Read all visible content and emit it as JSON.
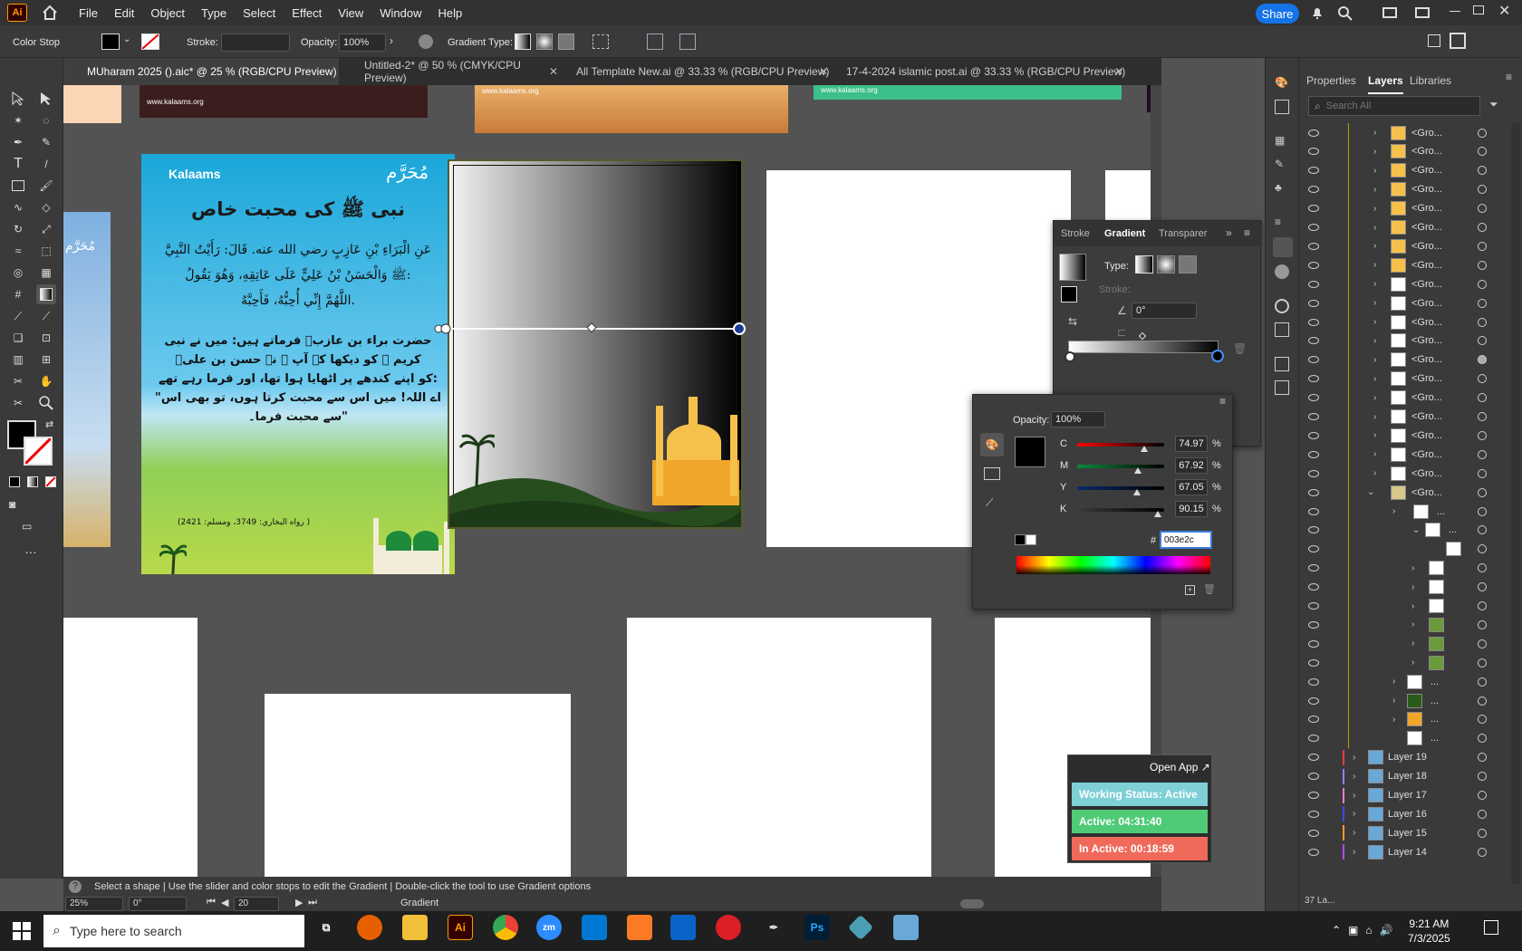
{
  "menubar": {
    "app_icon": "Ai",
    "items": [
      "File",
      "Edit",
      "Object",
      "Type",
      "Select",
      "Effect",
      "View",
      "Window",
      "Help"
    ],
    "share": "Share"
  },
  "control": {
    "mode": "Color Stop",
    "stroke_label": "Stroke:",
    "opacity_label": "Opacity:",
    "opacity": "100%",
    "gradient_type_label": "Gradient Type:"
  },
  "tabs": [
    {
      "label": "MUharam 2025 ().aic* @ 25 % (RGB/CPU Preview)",
      "active": true
    },
    {
      "label": "Untitled-2* @ 50 % (CMYK/CPU Preview)",
      "active": false
    },
    {
      "label": "All Template New.ai @ 33.33 % (RGB/CPU Preview)",
      "active": false
    },
    {
      "label": "17-4-2024 islamic post.ai @ 33.33 % (RGB/CPU Preview)",
      "active": false
    }
  ],
  "artwork": {
    "brand": "Kalaams",
    "site": "www.kalaams.org",
    "muharram": "مُحَرَّم",
    "title": "نبی ﷺ کی محبت خاص",
    "arabic": [
      "عَنِ الْبَرَاءِ بْنِ عَازِبٍ رضي الله عنه. قَالَ: رَأَيْتُ النَّبِيَّ",
      "ﷺ وَالْحَسَنُ بْنُ عَلِيٍّ عَلَى عَاتِقِهِ، وَهُوَ يَقُولُ:",
      "اللَّهُمَّ إِنِّي أُحِبُّهُ، فَأَحِبَّهُ."
    ],
    "urdu": [
      "حضرت براء بن عازبؓ فرماتے ہیں: میں نے نبی",
      "کریم ﷺ کو دیکھا کہ آپ ﷺ نے حسن بن علیؓ",
      "کو اپنے کندھے پر اٹھایا ہوا تھا، اور فرما رہے تھے:",
      "\"اے اللہ! میں اس سے محبت کرتا ہوں، تو بھی اس",
      "سے محبت فرما۔\""
    ],
    "ref": "(رواه البخاري: 3749، ومسلم: 2421 )"
  },
  "gradient_panel": {
    "tabs": [
      "Stroke",
      "Gradient",
      "Transparer"
    ],
    "type_label": "Type:",
    "stroke_label": "Stroke:",
    "angle": "0°"
  },
  "color_panel": {
    "opacity_label": "Opacity:",
    "opacity": "100%",
    "channels": [
      {
        "label": "C",
        "value": "74.97",
        "pct": 0.7497,
        "color": "#00aeef"
      },
      {
        "label": "M",
        "value": "67.92",
        "pct": 0.6792,
        "color": "#ec008c"
      },
      {
        "label": "Y",
        "value": "67.05",
        "pct": 0.6705,
        "color": "#fff200"
      },
      {
        "label": "K",
        "value": "90.15",
        "pct": 0.9015,
        "color": "#aaaaaa"
      }
    ],
    "pct_sign": "%",
    "hash": "#",
    "hex": "003e2c"
  },
  "layers_panel": {
    "tabs": [
      "Properties",
      "Layers",
      "Libraries"
    ],
    "search_placeholder": "Search All",
    "group_label": "<Gro...",
    "ellipsis": "...",
    "named_layers": [
      {
        "name": "Layer 19",
        "color": "#ff3b3b"
      },
      {
        "name": "Layer 18",
        "color": "#9a7bff"
      },
      {
        "name": "Layer 17",
        "color": "#ff7ad9"
      },
      {
        "name": "Layer 16",
        "color": "#3b4bff"
      },
      {
        "name": "Layer 15",
        "color": "#ff9a2a"
      },
      {
        "name": "Layer 14",
        "color": "#b14bff"
      }
    ],
    "footer_count": "37 La..."
  },
  "work_widget": {
    "open_app": "Open App ↗",
    "working_status": "Working Status: Active",
    "active": "Active: 04:31:40",
    "inactive": "In Active: 00:18:59"
  },
  "status": {
    "help": "?",
    "hint": "Select a shape  |  Use the slider and color stops to edit the Gradient  |  Double-click the tool to use Gradient options",
    "zoom": "25%",
    "rotation": "0°",
    "artboard": "20",
    "tool_name": "Gradient"
  },
  "taskbar": {
    "search_placeholder": "Type here to search",
    "time": "9:21 AM",
    "date": "7/3/2025"
  }
}
